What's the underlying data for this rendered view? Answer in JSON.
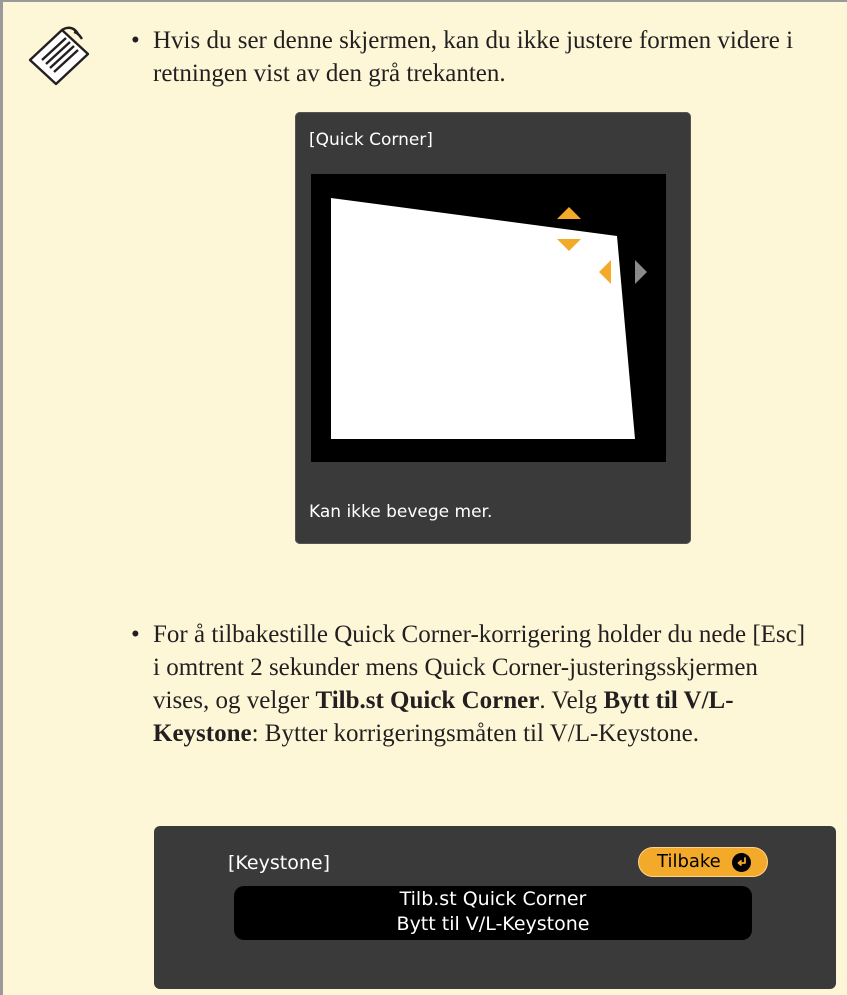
{
  "bullet_symbol": "•",
  "bullets": [
    {
      "pre": "Hvis du ser denne skjermen, kan du ikke justere formen videre i retningen vist av den grå trekanten."
    },
    {
      "pre": "For å tilbakestille Quick Corner-korrigering holder du nede [Esc] i omtrent 2 sekunder mens Quick Corner-justeringsskjermen vises, og velger ",
      "bold1": "Tilb.st Quick Corner",
      "mid": ". Velg ",
      "bold2": "Bytt til V/L-Keystone",
      "post": ": Bytter korrigeringsmåten til V/L-Keystone."
    }
  ],
  "quick_corner": {
    "title": "[Quick Corner]",
    "message": "Kan ikke bevege mer."
  },
  "keystone_menu": {
    "title": "[Keystone]",
    "back_label": "Tilbake",
    "items": [
      "Tilb.st Quick Corner",
      "Bytt til V/L-Keystone"
    ]
  },
  "colors": {
    "page_background": "#fdf7d8",
    "screen_background": "#3a3a3a",
    "arrow_active": "#f3a92a",
    "arrow_disabled": "#8a8a8a"
  },
  "icons": {
    "note": "note-icon",
    "arrow_up": "arrow-up-icon",
    "arrow_down": "arrow-down-icon",
    "arrow_left": "arrow-left-icon",
    "arrow_right": "arrow-right-icon",
    "enter": "enter-icon"
  }
}
